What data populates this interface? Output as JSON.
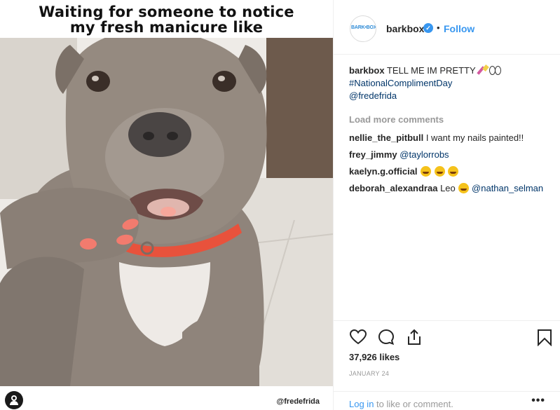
{
  "image": {
    "overlay_line_1": "Waiting for someone to notice",
    "overlay_line_2": "my fresh manicure like",
    "credit": "@fredefrida"
  },
  "header": {
    "avatar_text": "BARK•BOX",
    "username": "barkbox",
    "separator": "•",
    "follow_label": "Follow"
  },
  "caption": {
    "user": "barkbox",
    "text": "TELL ME IM PRETTY",
    "hashtag": "#NationalComplimentDay",
    "mention": "@fredefrida"
  },
  "load_more": "Load more comments",
  "comments": [
    {
      "user": "nellie_the_pitbull",
      "text": "I want my nails painted!!"
    },
    {
      "user": "frey_jimmy",
      "mention": "@taylorrobs"
    },
    {
      "user": "kaelyn.g.official"
    },
    {
      "user": "deborah_alexandraa",
      "text": "Leo",
      "mention": "@nathan_selman"
    }
  ],
  "likes": "37,926 likes",
  "date": "JANUARY 24",
  "login": {
    "link": "Log in",
    "rest": " to like or comment."
  },
  "more_label": "•••",
  "icons": [
    "heart-icon",
    "comment-icon",
    "share-icon",
    "bookmark-icon",
    "verified-icon"
  ],
  "colors": {
    "accent": "#3897f0",
    "link": "#003569",
    "muted": "#999999",
    "collar": "#e8523c",
    "nails": "#f27b6e"
  }
}
